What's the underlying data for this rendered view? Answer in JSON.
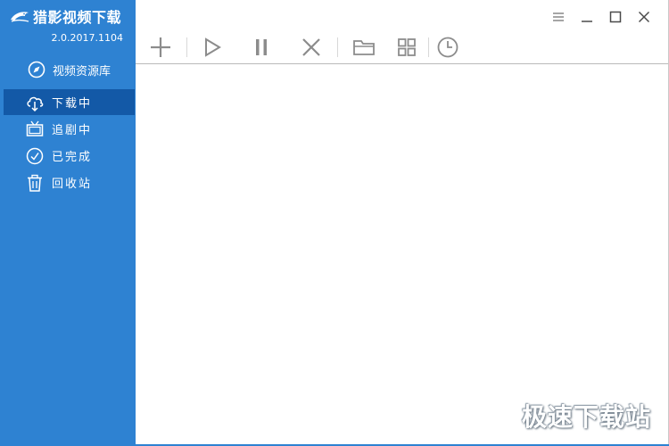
{
  "app": {
    "title": "猎影视频下载",
    "version": "2.0.2017.1104"
  },
  "sidebar": {
    "library": {
      "label": "视频资源库",
      "icon": "compass-icon"
    },
    "items": [
      {
        "label": "下载中",
        "icon": "cloud-download-icon",
        "active": true
      },
      {
        "label": "追剧中",
        "icon": "tv-icon",
        "active": false
      },
      {
        "label": "已完成",
        "icon": "check-circle-icon",
        "active": false
      },
      {
        "label": "回收站",
        "icon": "trash-icon",
        "active": false
      }
    ]
  },
  "toolbar": {
    "buttons": [
      "plus-icon",
      "play-icon",
      "pause-icon",
      "close-icon",
      "folder-icon",
      "grid-icon",
      "clock-icon"
    ]
  },
  "window_controls": [
    "menu-icon",
    "minimize-icon",
    "maximize-icon",
    "close-window-icon"
  ],
  "watermark": "极速下载站",
  "colors": {
    "sidebar": "#2e82d2",
    "sidebar_active": "#1359a7",
    "icon_gray": "#8c8c8c"
  }
}
